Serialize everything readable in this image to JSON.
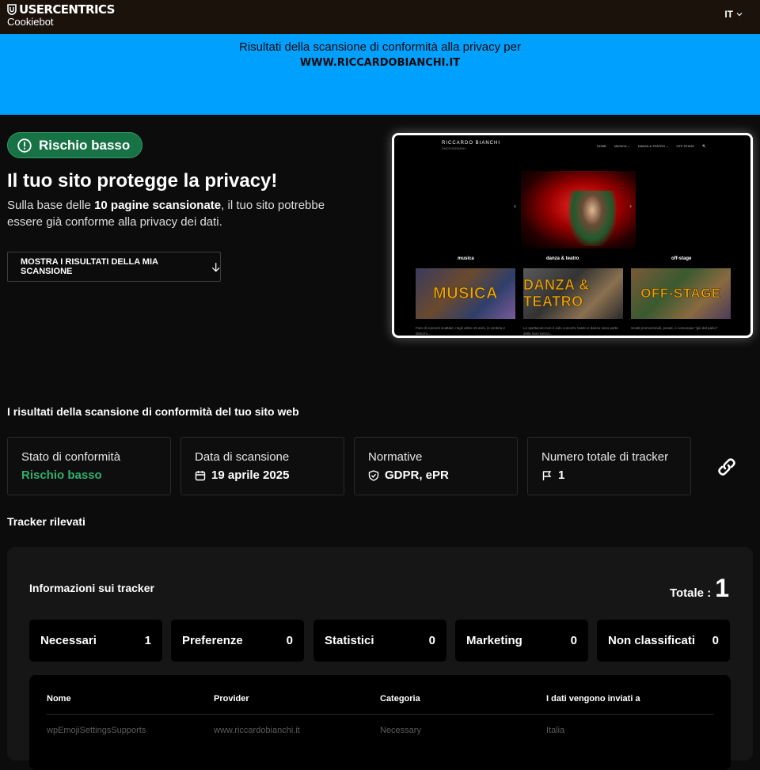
{
  "header": {
    "brand": "USERCENTRICS",
    "product": "Cookiebot",
    "language": "IT"
  },
  "banner": {
    "line1": "Risultati della scansione di conformità alla privacy per",
    "site": "WWW.RICCARDOBIANCHI.IT"
  },
  "hero": {
    "badge": "Rischio basso",
    "title": "Il tuo sito protegge la privacy!",
    "text_before": "Sulla base delle ",
    "text_bold": "10 pagine scansionate",
    "text_after": ", il tuo sito potrebbe essere già conforme alla privacy dei dati.",
    "button": "MOSTRA I RISULTATI DELLA MIA SCANSIONE"
  },
  "preview": {
    "brand": "RICCARDO BIANCHI",
    "brand_sub": "PHOTOGRAPHY",
    "nav": [
      "HOME",
      "MUSICA ⌄",
      "DANZA & TEATRO ⌄",
      "OFF-STAGE",
      "🔍"
    ],
    "captions": [
      "musica",
      "danza & teatro",
      "off-stage"
    ],
    "tiles": [
      "MUSICA",
      "DANZA & TEATRO",
      "OFF-STAGE"
    ],
    "descs": [
      "Foto di concerti scattate, negli ultimi 15 anni, in Umbria e dintorni...",
      "Lo spettacolo non è solo concerti, teatro e danza sono parte della mia ricerca...",
      "Scatti promozionali, posati, o comunque \"giù dal palco\""
    ]
  },
  "results": {
    "title": "I risultati della scansione di conformità del tuo sito web",
    "cards": [
      {
        "label": "Stato di conformità",
        "value": "Rischio basso",
        "icon": "none"
      },
      {
        "label": "Data di scansione",
        "value": "19 aprile 2025",
        "icon": "calendar-icon"
      },
      {
        "label": "Normative",
        "value": "GDPR, ePR",
        "icon": "shield-check-icon"
      },
      {
        "label": "Numero totale di tracker",
        "value": "1",
        "icon": "flag-icon"
      }
    ]
  },
  "trackers": {
    "section_title": "Tracker rilevati",
    "panel_title": "Informazioni sui tracker",
    "total_label": "Totale :",
    "total_value": "1",
    "categories": [
      {
        "label": "Necessari",
        "count": "1"
      },
      {
        "label": "Preferenze",
        "count": "0"
      },
      {
        "label": "Statistici",
        "count": "0"
      },
      {
        "label": "Marketing",
        "count": "0"
      },
      {
        "label": "Non classificati",
        "count": "0"
      }
    ],
    "columns": [
      "Nome",
      "Provider",
      "Categoria",
      "I dati vengono inviati a"
    ],
    "rows": [
      {
        "name": "wpEmojiSettingsSupports",
        "provider": "www.riccardobianchi.it",
        "category": "Necessary",
        "destination": "Italia"
      }
    ]
  },
  "colors": {
    "topbar": "#1c120c",
    "banner": "#00a0ff",
    "risk_green": "#177245",
    "risk_text_green": "#2fae6e",
    "background": "#0c0c0c",
    "panel": "#161616"
  }
}
